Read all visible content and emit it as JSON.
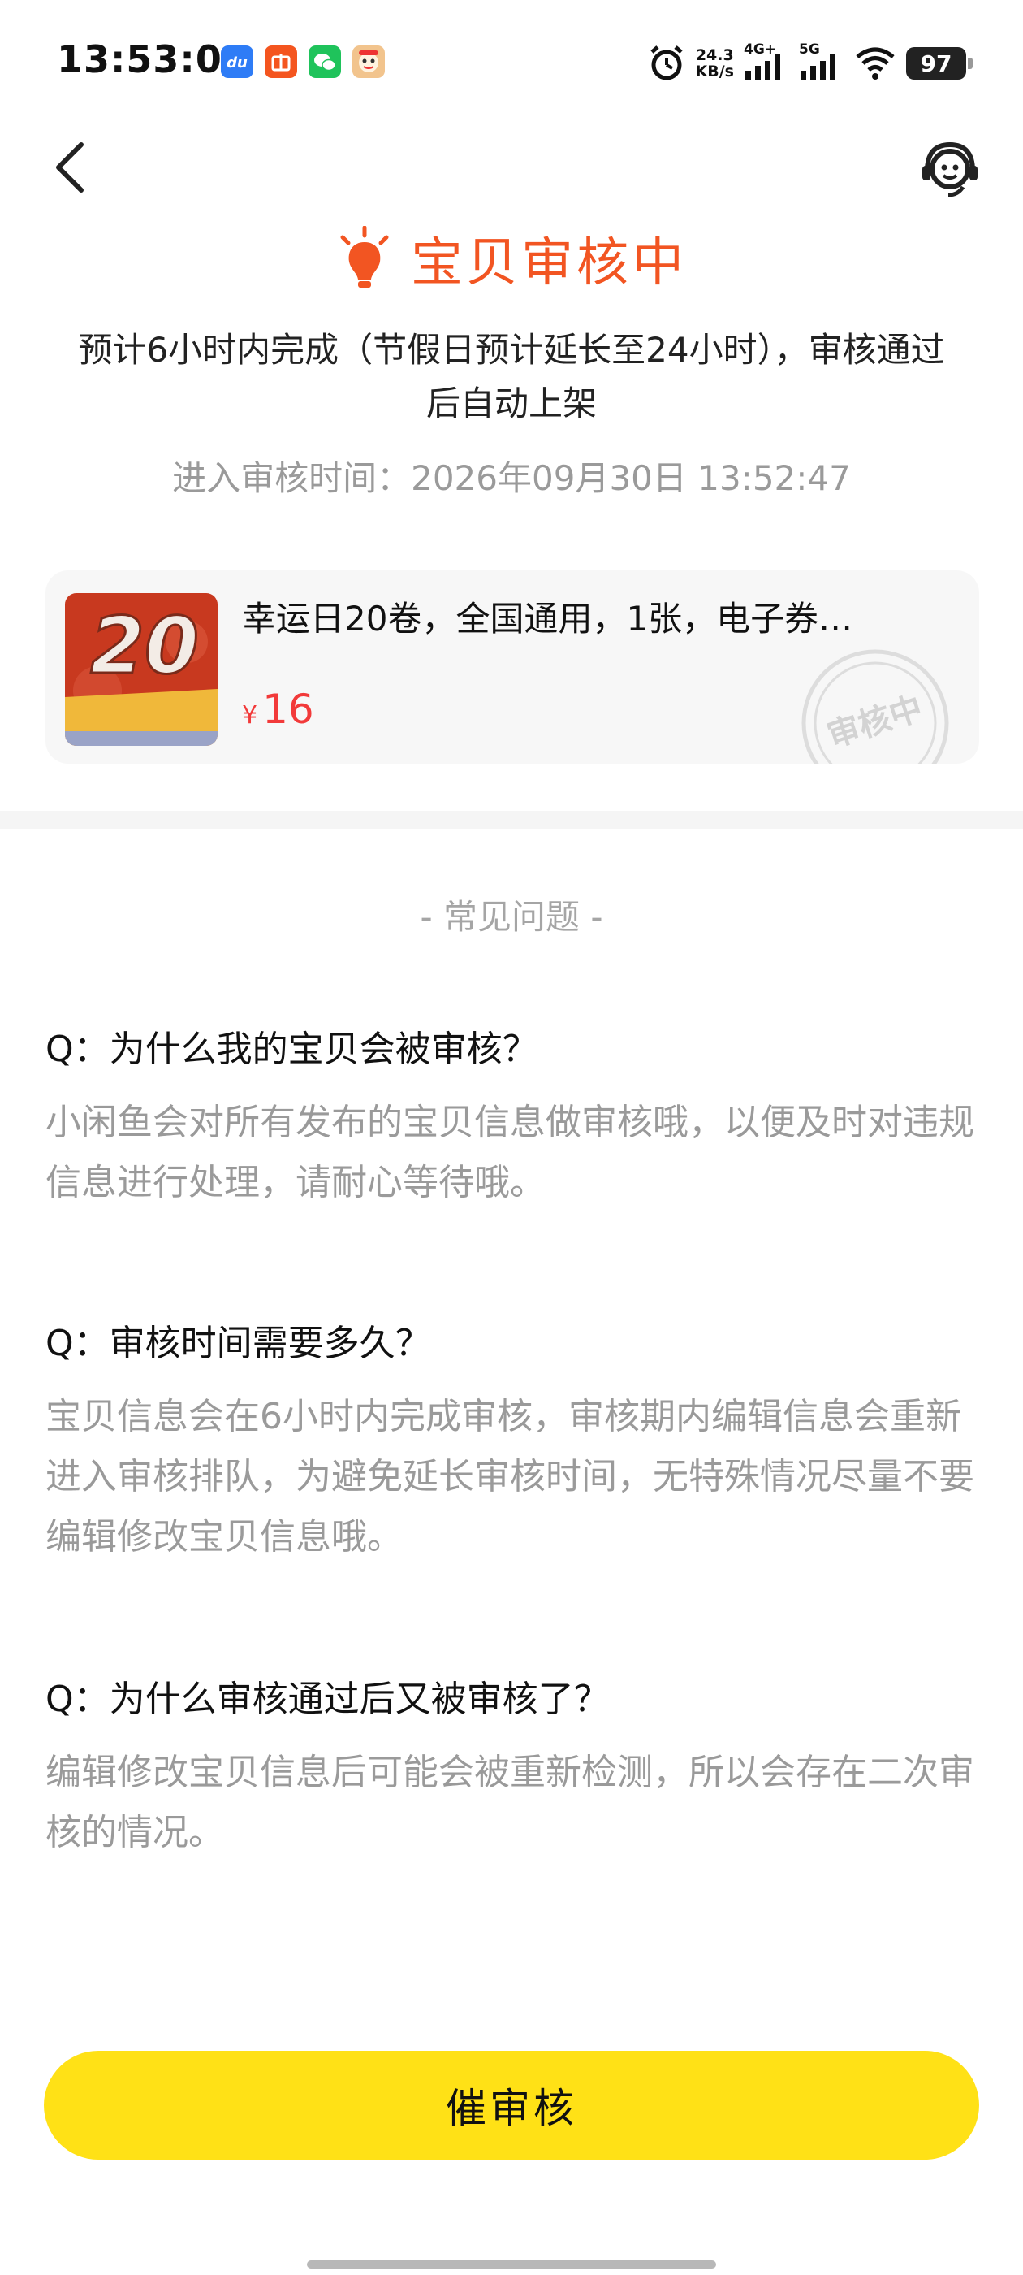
{
  "status_bar": {
    "time": "13:53:01",
    "net_speed_value": "24.3",
    "net_speed_unit": "KB/s",
    "signal1_label": "4G+",
    "signal2_label": "5G",
    "battery": "97",
    "notification_icons": [
      "du-app-icon",
      "gift-app-icon",
      "wechat-icon",
      "monkey-app-icon"
    ]
  },
  "header": {
    "status_title": "宝贝审核中",
    "description": "预计6小时内完成（节假日预计延长至24小时），审核通过后自动上架",
    "enter_review_time": "进入审核时间：2026年09月30日 13:52:47"
  },
  "item": {
    "title": "幸运日20卷，全国通用，1张，电子券…",
    "price_symbol": "¥",
    "price": "16",
    "thumb_text": "20",
    "stamp_text": "审核中"
  },
  "faq": {
    "heading": "- 常见问题 -",
    "items": [
      {
        "q": "Q：为什么我的宝贝会被审核？",
        "a": "小闲鱼会对所有发布的宝贝信息做审核哦，以便及时对违规信息进行处理，请耐心等待哦。"
      },
      {
        "q": "Q：审核时间需要多久？",
        "a": "宝贝信息会在6小时内完成审核，审核期内编辑信息会重新进入审核排队，为避免延长审核时间，无特殊情况尽量不要编辑修改宝贝信息哦。"
      },
      {
        "q": "Q：为什么审核通过后又被审核了？",
        "a": "编辑修改宝贝信息后可能会被重新检测，所以会存在二次审核的情况。"
      }
    ]
  },
  "action": {
    "urge_label": "催审核"
  },
  "colors": {
    "accent_orange": "#f25522",
    "price_red": "#f23a3a",
    "button_yellow": "#ffe116",
    "muted_gray": "#9a9a9a"
  }
}
